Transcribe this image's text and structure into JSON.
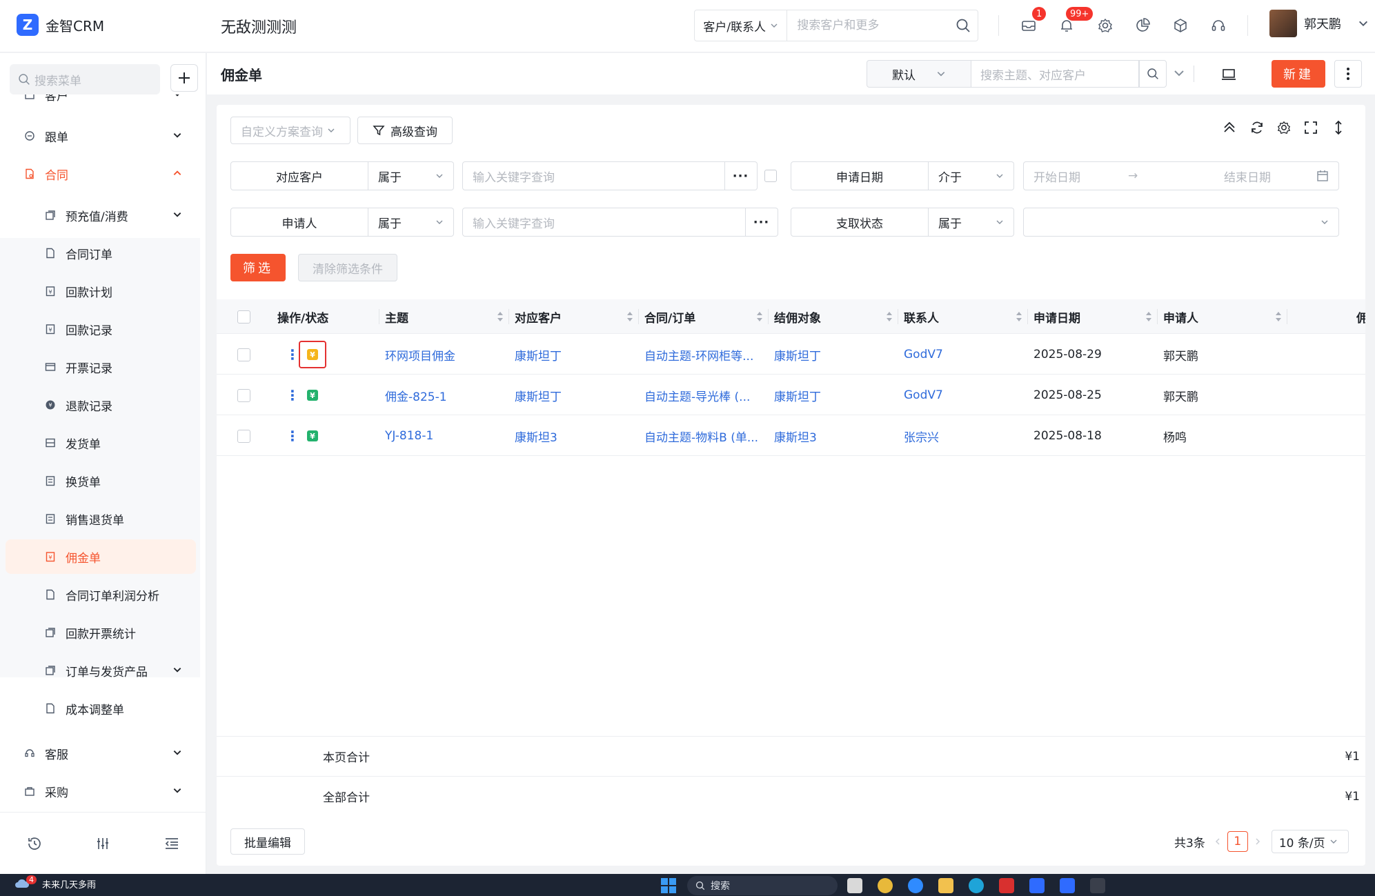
{
  "app": {
    "logo": "金智CRM",
    "workspace": "无敌测测测"
  },
  "topbar": {
    "search_type": "客户/联系人",
    "search_placeholder": "搜索客户和更多",
    "mail_badge": "1",
    "notify_badge": "99+",
    "user_name": "郭天鹏"
  },
  "sidebar": {
    "search_placeholder": "搜索菜单",
    "items": [
      {
        "label": "客户"
      },
      {
        "label": "跟单"
      },
      {
        "label": "合同"
      },
      {
        "label": "预充值/消费"
      },
      {
        "label": "合同订单"
      },
      {
        "label": "回款计划"
      },
      {
        "label": "回款记录"
      },
      {
        "label": "开票记录"
      },
      {
        "label": "退款记录"
      },
      {
        "label": "发货单"
      },
      {
        "label": "换货单"
      },
      {
        "label": "销售退货单"
      },
      {
        "label": "佣金单"
      },
      {
        "label": "合同订单利润分析"
      },
      {
        "label": "回款开票统计"
      },
      {
        "label": "订单与发货产品"
      },
      {
        "label": "成本调整单"
      },
      {
        "label": "客服"
      },
      {
        "label": "采购"
      },
      {
        "label": ""
      }
    ]
  },
  "header": {
    "title": "佣金单",
    "view": "默认",
    "search_placeholder": "搜索主题、对应客户",
    "new_label": "新建"
  },
  "filters": {
    "plan_placeholder": "自定义方案查询",
    "advanced_label": "高级查询",
    "customer_label": "对应客户",
    "customer_op": "属于",
    "customer_placeholder": "输入关键字查询",
    "date_label": "申请日期",
    "date_op": "介于",
    "date_start_placeholder": "开始日期",
    "date_arrow": "→",
    "date_end_placeholder": "结束日期",
    "applicant_label": "申请人",
    "applicant_op": "属于",
    "applicant_placeholder": "输入关键字查询",
    "pay_label": "支取状态",
    "pay_op": "属于",
    "filter_btn": "筛选",
    "clear_btn": "清除筛选条件"
  },
  "table": {
    "columns": [
      "操作/状态",
      "主题",
      "对应客户",
      "合同/订单",
      "结佣对象",
      "联系人",
      "申请日期",
      "申请人",
      "佣"
    ],
    "rows": [
      {
        "status_color": "#f5b51b",
        "subject": "环网项目佣金",
        "customer": "康斯坦丁",
        "contract": "自动主题-环网柜等...",
        "target": "康斯坦丁",
        "contact": "GodV7",
        "date": "2025-08-29",
        "applicant": "郭天鹏"
      },
      {
        "status_color": "#23b26d",
        "subject": "佣金-825-1",
        "customer": "康斯坦丁",
        "contract": "自动主题-导光棒 (...",
        "target": "康斯坦丁",
        "contact": "GodV7",
        "date": "2025-08-25",
        "applicant": "郭天鹏"
      },
      {
        "status_color": "#23b26d",
        "subject": "YJ-818-1",
        "customer": "康斯坦3",
        "contract": "自动主题-物料B (单...",
        "target": "康斯坦3",
        "contact": "张宗兴",
        "date": "2025-08-18",
        "applicant": "杨鸣"
      }
    ],
    "status_glyph": "¥",
    "page_total_label": "本页合计",
    "page_total_value": "¥1",
    "all_total_label": "全部合计",
    "all_total_value": "¥1"
  },
  "footer": {
    "batch_label": "批量编辑",
    "total": "共3条",
    "page": "1",
    "page_size": "10 条/页"
  },
  "taskbar": {
    "weather_badge": "4",
    "weather": "未来几天多雨",
    "search": "搜索"
  }
}
